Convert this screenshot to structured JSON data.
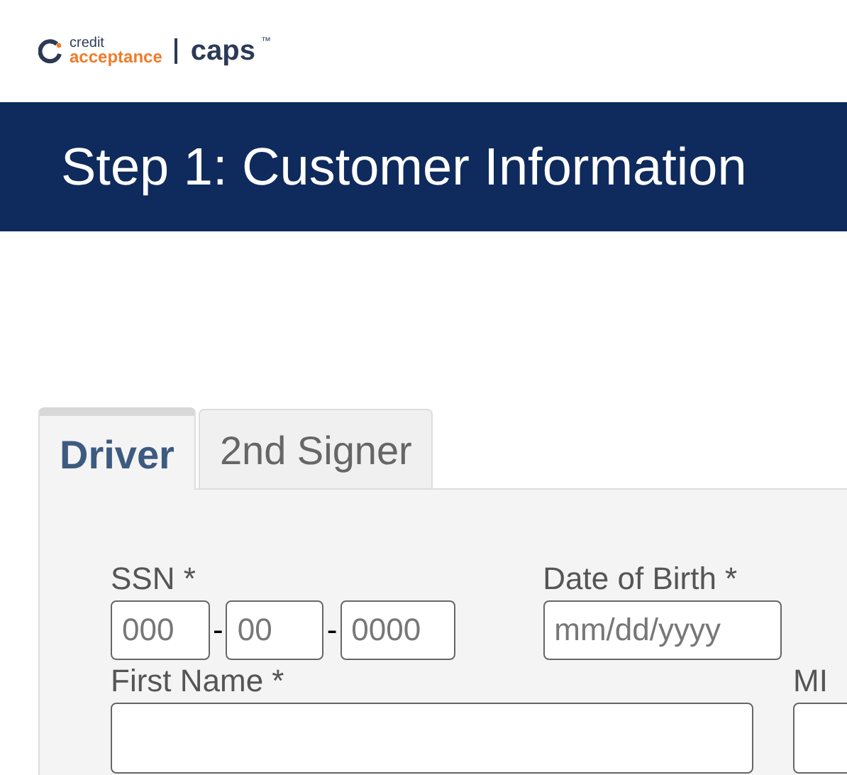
{
  "logo": {
    "word_top": "credit",
    "word_bottom": "acceptance",
    "product": "caps",
    "trademark": "™"
  },
  "banner": {
    "title": "Step 1: Customer Information"
  },
  "tabs": [
    {
      "label": "Driver",
      "selected": true
    },
    {
      "label": "2nd Signer",
      "selected": false
    }
  ],
  "form": {
    "ssn": {
      "label": "SSN *",
      "parts": [
        {
          "placeholder": "000"
        },
        {
          "placeholder": "00"
        },
        {
          "placeholder": "0000"
        }
      ],
      "separators": [
        "-",
        "-"
      ]
    },
    "date_of_birth": {
      "label": "Date of Birth *",
      "placeholder": "mm/dd/yyyy"
    },
    "first_name": {
      "label": "First Name *"
    },
    "mi": {
      "label": "MI"
    }
  }
}
